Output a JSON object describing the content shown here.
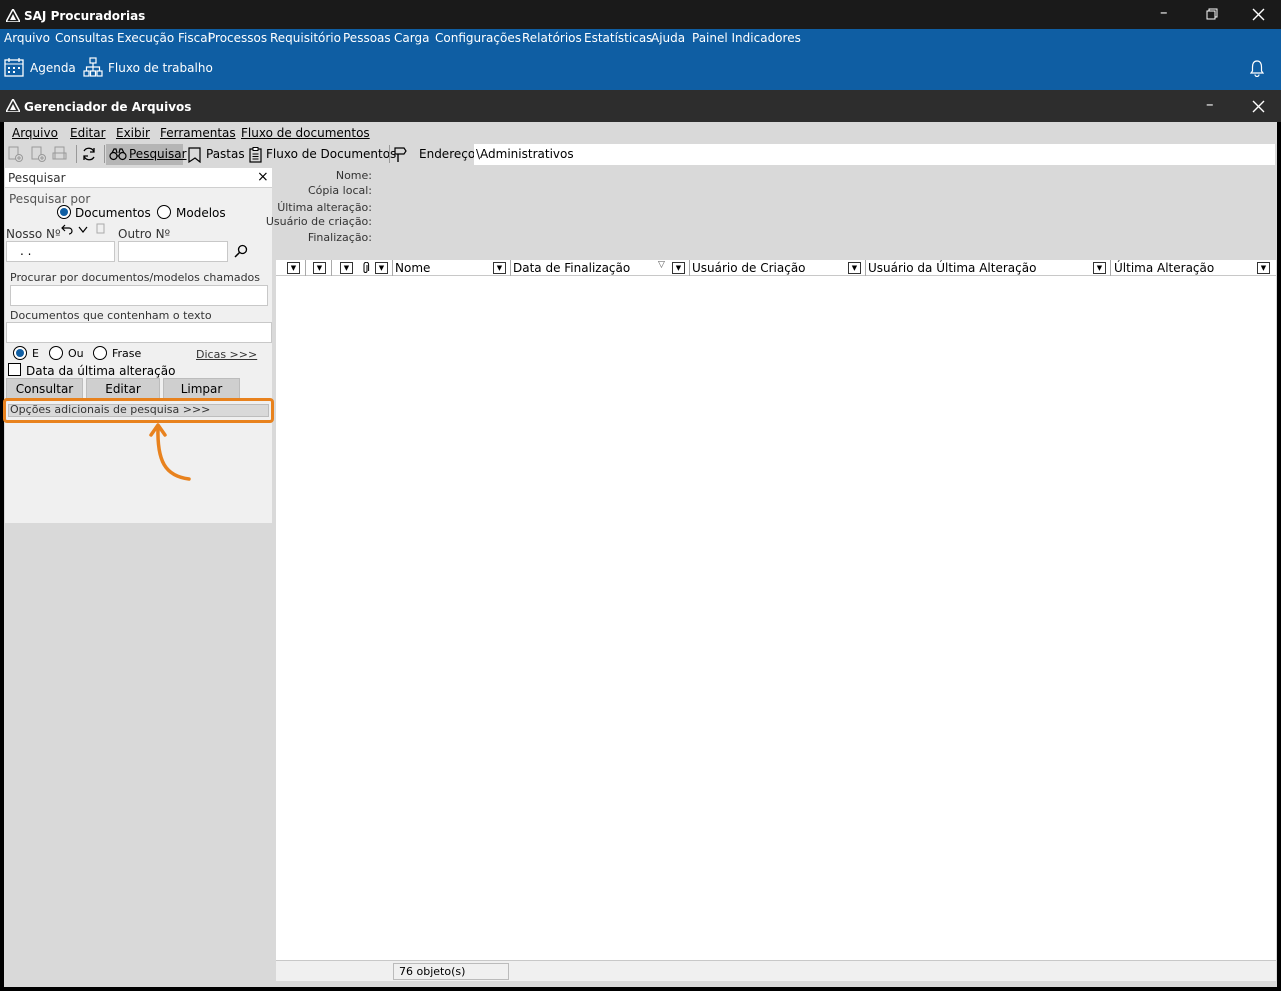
{
  "app": {
    "title": "SAJ Procuradorias"
  },
  "menu": [
    "Arquivo",
    "Consultas",
    "Execução Fiscal",
    "Processos",
    "Requisitório",
    "Pessoas",
    "Carga",
    "Configurações",
    "Relatórios",
    "Estatísticas",
    "Ajuda",
    "Painel Indicadores"
  ],
  "toolbar": {
    "agenda": "Agenda",
    "workflow": "Fluxo de trabalho"
  },
  "subwindow": {
    "title": "Gerenciador de Arquivos",
    "menu": [
      "Arquivo",
      "Editar",
      "Exibir",
      "Ferramentas",
      "Fluxo de documentos"
    ],
    "toolbar": {
      "search": "Pesquisar",
      "folders": "Pastas",
      "docflow": "Fluxo de Documentos",
      "address_label": "Endereço",
      "address_value": "\\Administrativos"
    }
  },
  "search_panel": {
    "title": "Pesquisar",
    "search_by_label": "Pesquisar por",
    "documents": "Documentos",
    "models": "Modelos",
    "our_number_label": "Nosso Nº",
    "our_number_value": ". .",
    "other_number_label": "Outro Nº",
    "name_label": "Procurar por documentos/modelos chamados",
    "text_label": "Documentos que contenham o texto",
    "op_and": "E",
    "op_or": "Ou",
    "op_phrase": "Frase",
    "tips": "Dicas >>>",
    "date_check": "Data da última alteração",
    "btn_query": "Consultar",
    "btn_edit": "Editar",
    "btn_clear": "Limpar",
    "more_options": "Opções adicionais de pesquisa >>>"
  },
  "details": {
    "name": "Nome:",
    "local_copy": "Cópia local:",
    "last_change": "Última alteração:",
    "creator": "Usuário de criação:",
    "finalization": "Finalização:"
  },
  "grid": {
    "columns": [
      "Nome",
      "Data de Finalização",
      "Usuário de Criação",
      "Usuário da Última Alteração",
      "Última Alteração"
    ]
  },
  "status": {
    "count": "76 objeto(s)"
  },
  "colors": {
    "accent": "#0f5ea3",
    "highlight": "#e8821e"
  }
}
